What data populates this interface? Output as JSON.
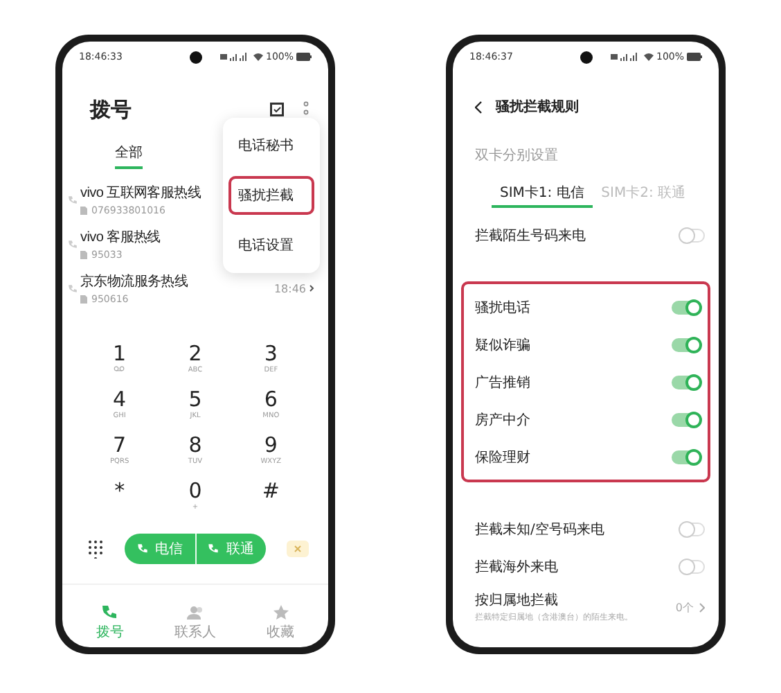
{
  "left_phone": {
    "status_bar": {
      "time": "18:46:33",
      "battery": "100%"
    },
    "title": "拨号",
    "tabs": [
      {
        "label": "全部",
        "selected": true
      }
    ],
    "calls": [
      {
        "name": "vivo 互联网客服热线",
        "number": "076933801016"
      },
      {
        "name": "vivo 客服热线",
        "number": "95033"
      },
      {
        "name": "京东物流服务热线",
        "number": "950616",
        "time": "18:46"
      }
    ],
    "menu": [
      {
        "label": "电话秘书",
        "highlighted": false
      },
      {
        "label": "骚扰拦截",
        "highlighted": true
      },
      {
        "label": "电话设置",
        "highlighted": false
      }
    ],
    "keys": [
      {
        "kind": "voicemail",
        "digit": "1"
      },
      {
        "kind": "digit",
        "digit": "2",
        "letters": "ABC"
      },
      {
        "kind": "digit",
        "digit": "3",
        "letters": "DEF"
      },
      {
        "kind": "digit",
        "digit": "4",
        "letters": "GHI"
      },
      {
        "kind": "digit",
        "digit": "5",
        "letters": "JKL"
      },
      {
        "kind": "digit",
        "digit": "6",
        "letters": "MNO"
      },
      {
        "kind": "digit",
        "digit": "7",
        "letters": "PQRS"
      },
      {
        "kind": "digit",
        "digit": "8",
        "letters": "TUV"
      },
      {
        "kind": "digit",
        "digit": "9",
        "letters": "WXYZ"
      },
      {
        "kind": "digit",
        "digit": "*"
      },
      {
        "kind": "digit",
        "digit": "0",
        "letters": "+"
      },
      {
        "kind": "digit",
        "digit": "#"
      }
    ],
    "call_buttons": [
      {
        "label": "电信"
      },
      {
        "label": "联通"
      }
    ],
    "nav": [
      {
        "label": "拨号",
        "selected": true,
        "kind": "phone"
      },
      {
        "label": "联系人",
        "selected": false,
        "kind": "contacts"
      },
      {
        "label": "收藏",
        "selected": false,
        "kind": "star"
      }
    ]
  },
  "right_phone": {
    "status_bar": {
      "time": "18:46:37",
      "battery": "100%"
    },
    "title": "骚扰拦截规则",
    "section_label": "双卡分别设置",
    "sim_tabs": [
      {
        "label": "SIM卡1: 电信",
        "selected": true
      },
      {
        "label": "SIM卡2: 联通",
        "selected": false
      }
    ],
    "settings": [
      {
        "kind": "toggle",
        "label": "拦截陌生号码来电",
        "on": false
      }
    ],
    "highlighted_settings": [
      {
        "kind": "toggle",
        "label": "骚扰电话",
        "on": true
      },
      {
        "kind": "toggle",
        "label": "疑似诈骗",
        "on": true
      },
      {
        "kind": "toggle",
        "label": "广告推销",
        "on": true
      },
      {
        "kind": "toggle",
        "label": "房产中介",
        "on": true
      },
      {
        "kind": "toggle",
        "label": "保险理财",
        "on": true
      }
    ],
    "more_settings": [
      {
        "kind": "toggle",
        "label": "拦截未知/空号码来电",
        "on": false
      },
      {
        "kind": "toggle",
        "label": "拦截海外来电",
        "on": false
      },
      {
        "kind": "link",
        "label": "按归属地拦截",
        "subtitle": "拦截特定归属地（含港澳台）的陌生来电。",
        "value": "0个"
      }
    ]
  }
}
